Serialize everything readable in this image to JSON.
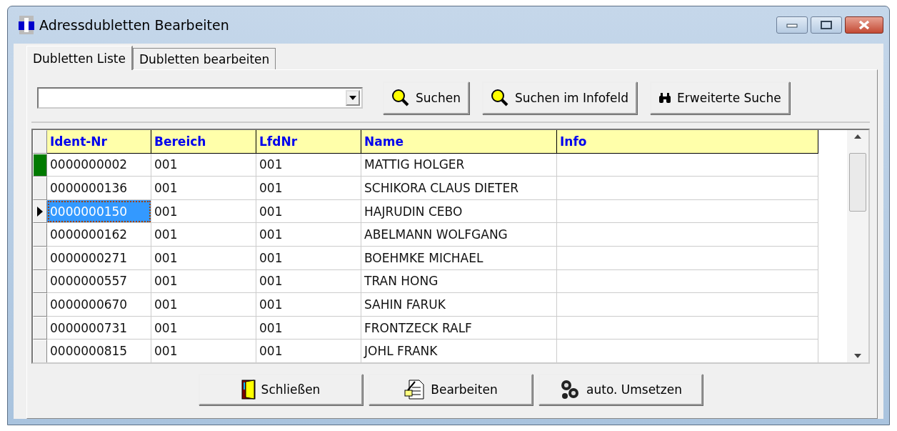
{
  "window": {
    "title": "Adressdubletten Bearbeiten"
  },
  "tabs": [
    {
      "label": "Dubletten Liste",
      "selected": true
    },
    {
      "label": "Dubletten bearbeiten",
      "selected": false
    }
  ],
  "toolbar": [
    {
      "label": "Suchen"
    },
    {
      "label": "Suchen im Infofeld"
    },
    {
      "label": "Erweiterte Suche"
    }
  ],
  "table": {
    "columns": [
      "Ident-Nr",
      "Bereich",
      "LfdNr",
      "Name",
      "Info"
    ],
    "rows": [
      {
        "cells": [
          "0000000002",
          "001",
          "001",
          "MATTIG HOLGER",
          ""
        ],
        "selected": false,
        "flagged": true
      },
      {
        "cells": [
          "0000000136",
          "001",
          "001",
          "SCHIKORA CLAUS DIETER",
          ""
        ],
        "selected": false,
        "flagged": false
      },
      {
        "cells": [
          "0000000150",
          "001",
          "001",
          "HAJRUDIN CEBO",
          ""
        ],
        "selected": true,
        "flagged": false
      },
      {
        "cells": [
          "0000000162",
          "001",
          "001",
          "ABELMANN WOLFGANG",
          ""
        ],
        "selected": false,
        "flagged": false
      },
      {
        "cells": [
          "0000000271",
          "001",
          "001",
          "BOEHMKE MICHAEL",
          ""
        ],
        "selected": false,
        "flagged": false
      },
      {
        "cells": [
          "0000000557",
          "001",
          "001",
          "TRAN HONG",
          ""
        ],
        "selected": false,
        "flagged": false
      },
      {
        "cells": [
          "0000000670",
          "001",
          "001",
          "SAHIN FARUK",
          ""
        ],
        "selected": false,
        "flagged": false
      },
      {
        "cells": [
          "0000000731",
          "001",
          "001",
          "FRONTZECK RALF",
          ""
        ],
        "selected": false,
        "flagged": false
      },
      {
        "cells": [
          "0000000815",
          "001",
          "001",
          "JOHL FRANK",
          ""
        ],
        "selected": false,
        "flagged": false
      }
    ]
  },
  "buttons": [
    {
      "label": "Schließen"
    },
    {
      "label": "Bearbeiten"
    },
    {
      "label": "auto. Umsetzen"
    }
  ]
}
